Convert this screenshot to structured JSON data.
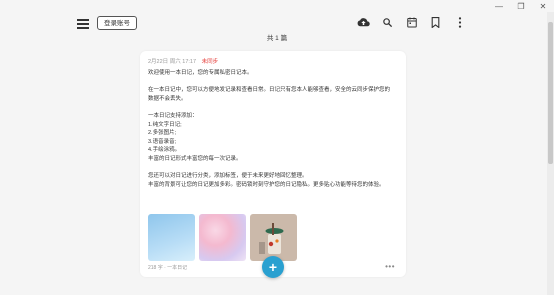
{
  "window": {
    "minimize": "—",
    "restore": "❐",
    "close": "✕"
  },
  "header": {
    "login_label": "登录账号",
    "icons": [
      "cloud-upload-icon",
      "search-icon",
      "calendar-icon",
      "bookmark-icon",
      "more-vert-icon"
    ]
  },
  "count_label": "共 1 篇",
  "entry": {
    "date": "2月22日",
    "weekday": "周六",
    "time": "17:17",
    "sync_status": "未同步",
    "lines": [
      "欢迎使用一本日记，您的专属私密日记本。",
      "",
      "在一本日记中，您可以方便地发记录和查看日常。日记只有您本人能够查看，安全的云同步保护您的",
      "数据不会丢失。",
      "",
      "一本日记支持添加：",
      "1.纯文字日记;",
      "2.多张图片;",
      "3.语音录音;",
      "4.手绘涂鸦。",
      "丰富的日记形式丰富您的每一次记录。",
      "",
      "您还可以对日记进行分类，添加标签，便于未来更好地回忆整理。",
      "丰富的背景可让您的日记更加多彩。密码锁时刻守护您的日记隐私。更多贴心功能等待您的体验。"
    ],
    "footer": "218 字 · 一本日记"
  },
  "fab_label": "+"
}
